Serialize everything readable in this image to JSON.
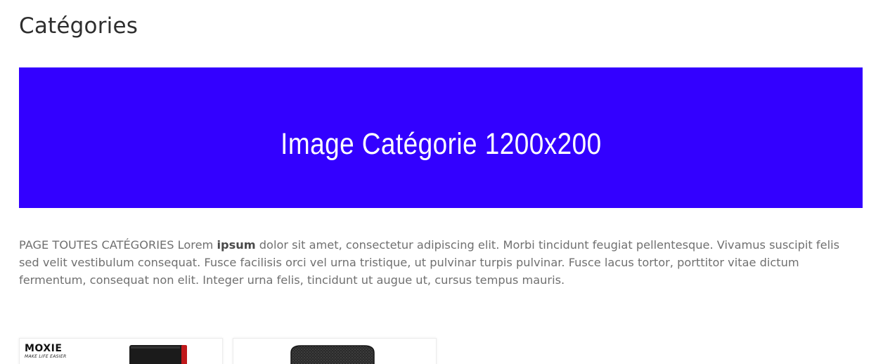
{
  "page": {
    "title": "Catégories"
  },
  "banner": {
    "text": "Image Catégorie 1200x200",
    "background_color": "#3300ff"
  },
  "description": {
    "prefix": "PAGE TOUTES CATÉGORIES Lorem ",
    "bold": "ipsum",
    "suffix": " dolor sit amet, consectetur adipiscing elit. Morbi tincidunt feugiat pellentesque. Vivamus suscipit felis sed velit vestibulum consequat. Fusce facilisis orci vel urna tristique, ut pulvinar turpis pulvinar. Fusce lacus tortor, porttitor vitae dictum fermentum, consequat non elit. Integer urna felis, tincidunt ut augue ut, cursus tempus mauris."
  },
  "categories": [
    {
      "brand": "MOXIE",
      "tagline": "MAKE LIFE EASIER",
      "image_icon": "phone-case-photo"
    },
    {
      "image_icon": "leather-case-photo"
    }
  ]
}
